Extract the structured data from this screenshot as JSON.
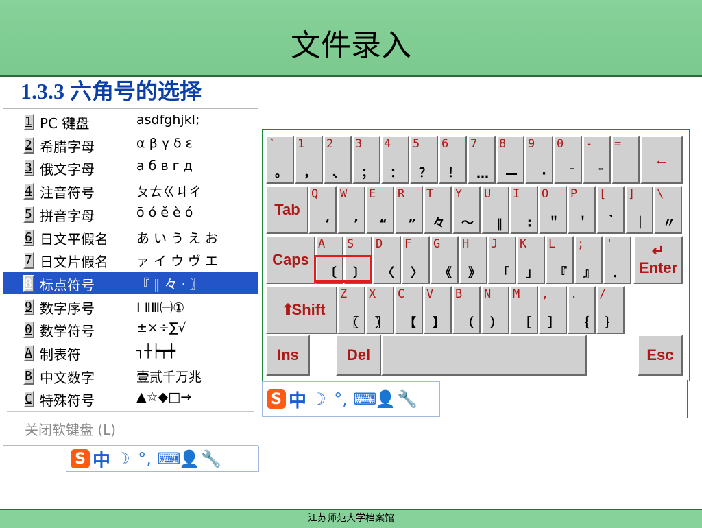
{
  "header": {
    "title": "文件录入"
  },
  "subtitle": "1.3.3 六角号的选择",
  "menu": {
    "items": [
      {
        "key": "1",
        "label": "PC 键盘",
        "preview": "asdfghjkl;"
      },
      {
        "key": "2",
        "label": "希腊字母",
        "preview": "α β γ δ ε"
      },
      {
        "key": "3",
        "label": "俄文字母",
        "preview": "а б в г д"
      },
      {
        "key": "4",
        "label": "注音符号",
        "preview": "ㄆㄊㄍㄐㄔ"
      },
      {
        "key": "5",
        "label": "拼音字母",
        "preview": "ō ó ě è ó"
      },
      {
        "key": "6",
        "label": "日文平假名",
        "preview": "あ い う え お"
      },
      {
        "key": "7",
        "label": "日文片假名",
        "preview": "ァ イ ウ ヴ エ"
      },
      {
        "key": "8",
        "label": "标点符号",
        "preview": "『 ‖ 々 · 〗"
      },
      {
        "key": "9",
        "label": "数字序号",
        "preview": "Ⅰ ⅡⅢ㈠①"
      },
      {
        "key": "0",
        "label": "数学符号",
        "preview": "±×÷∑√"
      },
      {
        "key": "A",
        "label": "制表符",
        "preview": "┐┼┝┯┿"
      },
      {
        "key": "B",
        "label": "中文数字",
        "preview": "壹贰千万兆"
      },
      {
        "key": "C",
        "label": "特殊符号",
        "preview": "▲☆◆□→"
      }
    ],
    "close_label": "关闭软键盘 (L)"
  },
  "keyboard": {
    "row1": [
      {
        "t": "`",
        "b": "。"
      },
      {
        "t": "1",
        "b": "，"
      },
      {
        "t": "2",
        "b": "、"
      },
      {
        "t": "3",
        "b": "；"
      },
      {
        "t": "4",
        "b": "："
      },
      {
        "t": "5",
        "b": "？"
      },
      {
        "t": "6",
        "b": "！"
      },
      {
        "t": "7",
        "b": "…"
      },
      {
        "t": "8",
        "b": "—"
      },
      {
        "t": "9",
        "b": "·"
      },
      {
        "t": "0",
        "b": "ˉ"
      },
      {
        "t": "-",
        "b": "¨"
      },
      {
        "t": "=",
        "b": ""
      }
    ],
    "backspace": "←",
    "row2": [
      {
        "t": "Q",
        "b": "‘"
      },
      {
        "t": "W",
        "b": "’"
      },
      {
        "t": "E",
        "b": "“"
      },
      {
        "t": "R",
        "b": "”"
      },
      {
        "t": "T",
        "b": "々"
      },
      {
        "t": "Y",
        "b": "～"
      },
      {
        "t": "U",
        "b": "‖"
      },
      {
        "t": "I",
        "b": "∶"
      },
      {
        "t": "O",
        "b": "＂"
      },
      {
        "t": "P",
        "b": "＇"
      },
      {
        "t": "[",
        "b": "｀"
      },
      {
        "t": "]",
        "b": "｜"
      },
      {
        "t": "\\",
        "b": "〃"
      }
    ],
    "tab": "Tab",
    "row3": [
      {
        "t": "A",
        "b": "〔"
      },
      {
        "t": "S",
        "b": "〕"
      },
      {
        "t": "D",
        "b": "〈"
      },
      {
        "t": "F",
        "b": "〉"
      },
      {
        "t": "G",
        "b": "《"
      },
      {
        "t": "H",
        "b": "》"
      },
      {
        "t": "J",
        "b": "「"
      },
      {
        "t": "K",
        "b": "」"
      },
      {
        "t": "L",
        "b": "『"
      },
      {
        "t": ";",
        "b": "』"
      },
      {
        "t": "'",
        "b": "．"
      }
    ],
    "caps": "Caps",
    "enter": "Enter",
    "enter_arrow": "↵",
    "row4": [
      {
        "t": "Z",
        "b": "〖"
      },
      {
        "t": "X",
        "b": "〗"
      },
      {
        "t": "C",
        "b": "【"
      },
      {
        "t": "V",
        "b": "】"
      },
      {
        "t": "B",
        "b": "（"
      },
      {
        "t": "N",
        "b": "）"
      },
      {
        "t": "M",
        "b": "［"
      },
      {
        "t": ",",
        "b": "］"
      },
      {
        "t": ".",
        "b": "｛"
      },
      {
        "t": "/",
        "b": "｝"
      }
    ],
    "shift": "Shift",
    "shift_arrow": "⬆",
    "ins": "Ins",
    "del": "Del",
    "esc": "Esc"
  },
  "toolbar": {
    "logo": "S",
    "mode": "中",
    "moon": "☽",
    "punct": "°,",
    "keyboard_icon": "⌨",
    "user_icon": "👤",
    "tools_icon": "🔧"
  },
  "footer": {
    "text": "江苏师范大学档案馆"
  },
  "colors": {
    "header_green": "#86d29a",
    "subtitle_blue": "#0b3fa8",
    "key_red": "#b01818",
    "selected_blue": "#2355c8",
    "highlight_red": "#e31b1b"
  }
}
